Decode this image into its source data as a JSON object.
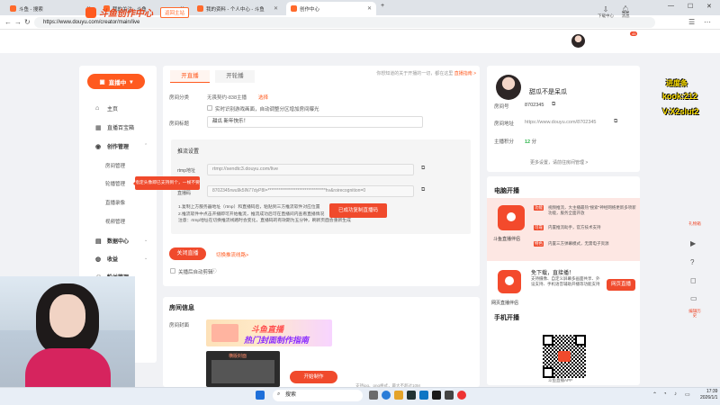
{
  "browser": {
    "tabs": [
      {
        "label": "斗鱼 - 搜索"
      },
      {
        "label": "我的关注 - 斗鱼"
      },
      {
        "label": "我的资料 - 个人中心 - 斗鱼"
      },
      {
        "label": "创作中心"
      }
    ],
    "url": "https://www.douyu.com/creator/main/live",
    "new_tab": "+"
  },
  "header": {
    "logo_text": "斗鱼创作中心",
    "back_home": "返回主站",
    "download": "下载中心",
    "messages": "消息",
    "msg_badge": "45"
  },
  "sidebar": {
    "live_button": "直播中",
    "items": [
      {
        "label": "主页"
      },
      {
        "label": "直播百宝箱"
      },
      {
        "label": "创作管理"
      },
      {
        "label": "房间管理"
      },
      {
        "label": "轮播管理"
      },
      {
        "label": "直播录像"
      },
      {
        "label": "视频管理"
      },
      {
        "label": "数据中心"
      },
      {
        "label": "收益"
      },
      {
        "label": "粉丝管理"
      }
    ]
  },
  "main": {
    "tab_live": "开直播",
    "tab_carousel": "开轮播",
    "notice": "你想知道的关于开播的一切，都在这里",
    "notice_link": "直播指南 >",
    "room_category_label": "房间分类",
    "room_category_value": "无畏契约-838主播",
    "room_category_select": "选择",
    "auto_cover": "实时识别游戏画面，自动调整分区增加房间曝光",
    "room_title_label": "房间标题",
    "room_title_value": "甜瓜 新年快乐！",
    "push_settings": "推流设置",
    "rtmp_label": "rtmp地址",
    "rtmp_value": "rtmp://sendtc3.douyu.com/live",
    "key_label": "直播码",
    "key_value": "8702345rwu9k5lN77dyP8I=*********************************hv&roirecognition=0",
    "copied_button": "已成功复制直播码",
    "tooltip": "指定头像即已支持到个，一帧不要呀~",
    "notes": [
      "1.复制上方服务器地址（rtmp）和直播码后，粘贴到三方推流软件对应位置",
      "2.推流软件中点击开播即可开始推流，推流成功后可在直播间内查看直播情况",
      "注意：rtmp地址在切换推流线路时会变化，直播码的有效期为五分钟，刷新页面会重新生成"
    ],
    "close_live": "关闭直播",
    "switch_link": "切换推流线路>",
    "auto_record": "关播后自动剪辑"
  },
  "room_info": {
    "title": "房间信息",
    "cover_label": "房间封面",
    "banner_line1": "斗鱼直播",
    "banner_line2": "热门封面制作指南",
    "thumb_label": "横版封面",
    "start_making": "开始制作",
    "thumb_hint": "支持jpg、png格式，最大不超过10M"
  },
  "profile": {
    "name": "甜瓜不是呆瓜",
    "room_no_label": "房间号",
    "room_no": "8702345",
    "room_addr_label": "房间地址",
    "room_addr": "https://www.douyu.com/8702345",
    "points_label": "主播积分",
    "points_value": "12",
    "points_unit": "分",
    "more": "更多设置，请前往房间管理 >"
  },
  "pc_live": {
    "title": "电脑开播",
    "app_name": "斗鱼直播伴侣",
    "tags": [
      "功能",
      "可靠",
      "特色"
    ],
    "descs": [
      "视频推流，大主播最热\"搜索\"神经网络更新多项新功能，服务全面开放",
      "内置推流助手，官方技术支持",
      "内置三方弹幕模式，无需电子资源"
    ],
    "free_title": "免下载，直接播！",
    "free_desc": "支持摄像、自定义屏幕多画面共享、外设支持、手机语音辅助开播等功能支持",
    "web_app": "网页直播伴侣",
    "web_btn": "网页直播",
    "mobile_title": "手机开播",
    "app_caption": "斗鱼直播APP"
  },
  "rail": {
    "top_label": "礼物箱",
    "bottom_label": "编辑历史"
  },
  "overlay": {
    "line1": "进度条",
    "line2": "kook:212",
    "line3": "V:X2slut2"
  },
  "taskbar": {
    "search": "搜索",
    "time": "17:39",
    "date": "2026/1/1"
  }
}
